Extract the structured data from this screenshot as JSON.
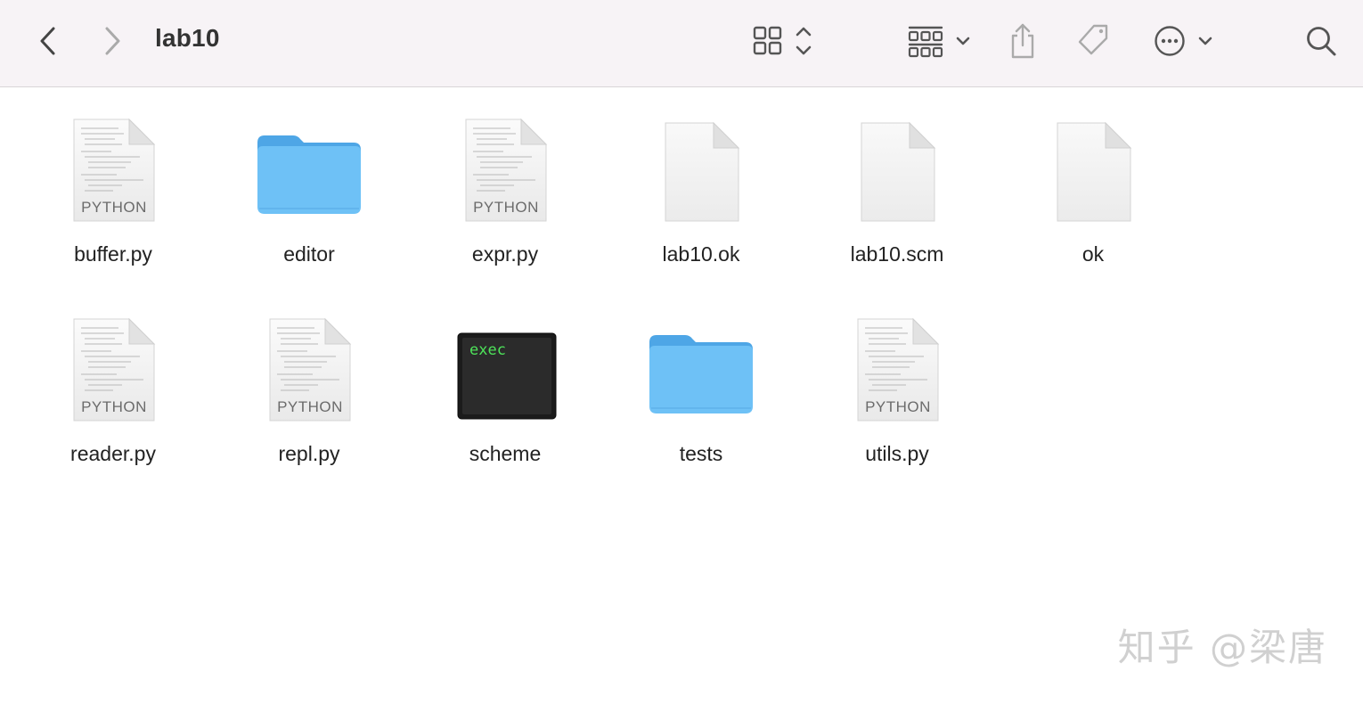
{
  "window": {
    "title": "lab10"
  },
  "toolbar": {
    "back_icon": "chevron-left-icon",
    "forward_icon": "chevron-right-icon",
    "view_icon": "grid-view-icon",
    "group_icon": "group-by-icon",
    "share_icon": "share-icon",
    "tag_icon": "tag-icon",
    "more_icon": "ellipsis-circle-icon",
    "search_icon": "search-icon"
  },
  "files": [
    {
      "name": "buffer.py",
      "kind": "python",
      "badge": "PYTHON"
    },
    {
      "name": "editor",
      "kind": "folder"
    },
    {
      "name": "expr.py",
      "kind": "python",
      "badge": "PYTHON"
    },
    {
      "name": "lab10.ok",
      "kind": "blank"
    },
    {
      "name": "lab10.scm",
      "kind": "blank"
    },
    {
      "name": "ok",
      "kind": "blank"
    },
    {
      "name": "reader.py",
      "kind": "python",
      "badge": "PYTHON"
    },
    {
      "name": "repl.py",
      "kind": "python",
      "badge": "PYTHON"
    },
    {
      "name": "scheme",
      "kind": "exec",
      "badge": "exec"
    },
    {
      "name": "tests",
      "kind": "folder"
    },
    {
      "name": "utils.py",
      "kind": "python",
      "badge": "PYTHON"
    }
  ],
  "watermark": "知乎 @梁唐",
  "colors": {
    "toolbar_bg": "#f7f3f6",
    "folder_blue": "#6ec1f6",
    "folder_tab": "#4ea6e6",
    "exec_green": "#4ee35a"
  }
}
